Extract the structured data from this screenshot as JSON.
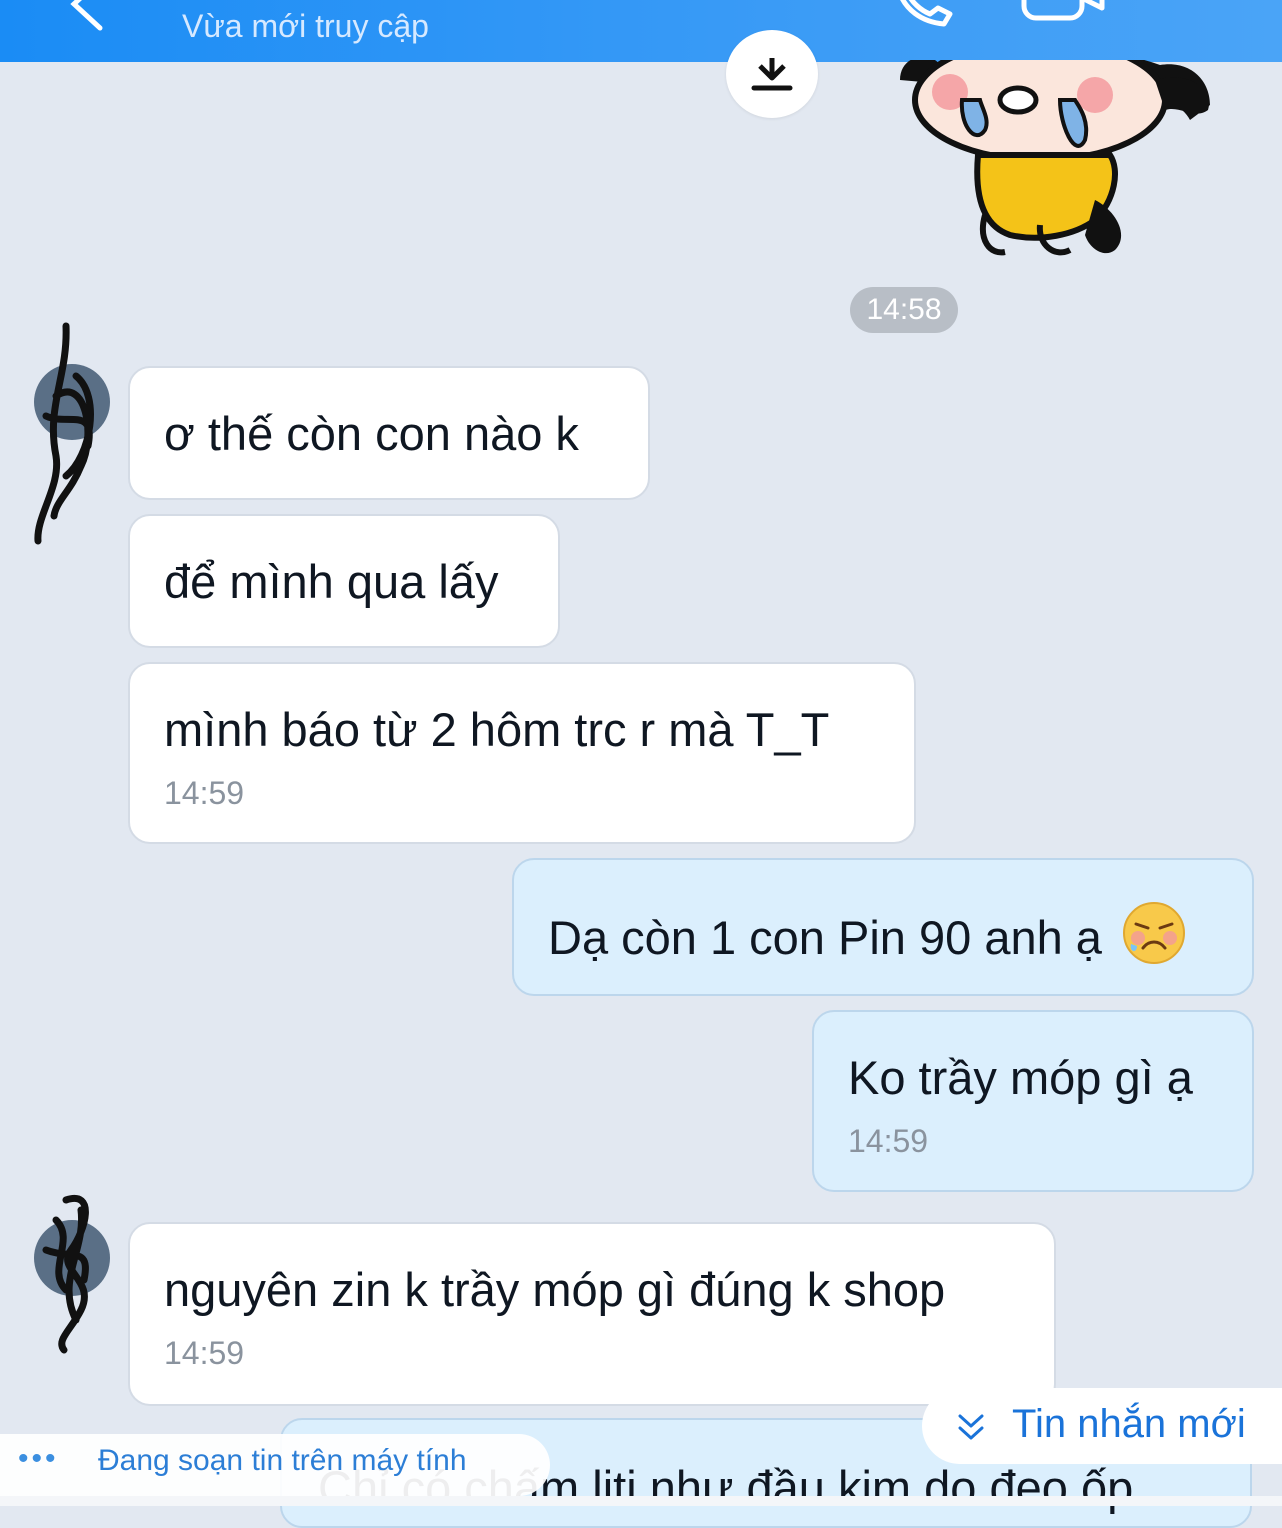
{
  "header": {
    "status": "Vừa mới truy cập"
  },
  "timestamp_divider": "14:58",
  "messages": [
    {
      "direction": "in",
      "text": "ơ thế còn con nào k",
      "time": ""
    },
    {
      "direction": "in",
      "text": "để mình qua lấy",
      "time": ""
    },
    {
      "direction": "in",
      "text": "mình báo từ 2 hôm trc r mà T_T",
      "time": "14:59"
    },
    {
      "direction": "out",
      "text": "Dạ còn 1 con Pin 90 anh ạ",
      "time": ""
    },
    {
      "direction": "out",
      "text": "Ko trầy móp gì ạ",
      "time": "14:59"
    },
    {
      "direction": "in",
      "text": "nguyên zin k trầy móp gì đúng k shop",
      "time": "14:59"
    },
    {
      "direction": "out",
      "text": "Chỉ có chấm liti như đầu kim do đeo ốp",
      "time": ""
    }
  ],
  "new_message_button": "Tin nhắn mới",
  "typing_indicator": {
    "dots": "•••",
    "label": "Đang soạn tin trên máy tính"
  },
  "colors": {
    "header": "#1a8cf5",
    "background": "#e2e8f1",
    "incoming_bubble": "#ffffff",
    "outgoing_bubble": "#dbeffd",
    "accent": "#1a73d9"
  }
}
